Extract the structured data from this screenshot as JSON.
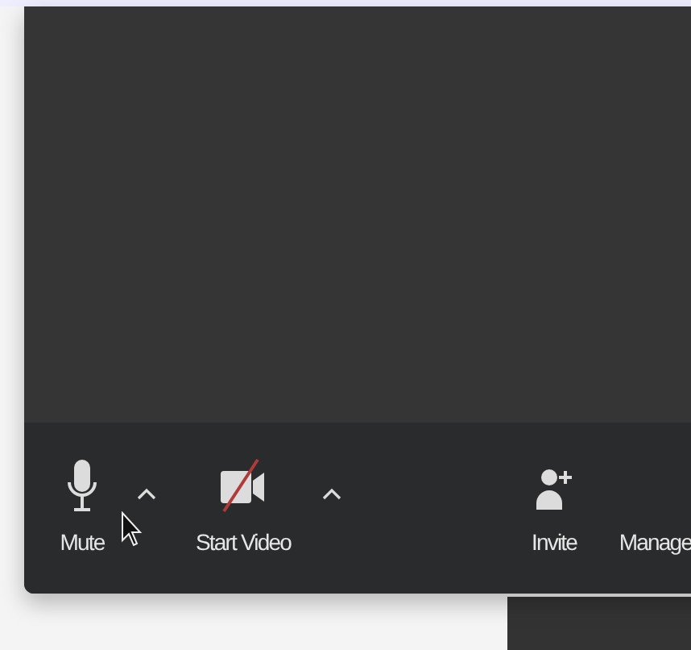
{
  "toolbar": {
    "items": [
      {
        "kind": "audio",
        "label": "Mute",
        "muted": false,
        "menu": true
      },
      {
        "kind": "video",
        "label": "Start Video",
        "video_on": false,
        "menu": true
      },
      {
        "kind": "invite",
        "label": "Invite",
        "menu": false
      },
      {
        "kind": "manage",
        "label": "Manage",
        "menu": false
      }
    ]
  }
}
